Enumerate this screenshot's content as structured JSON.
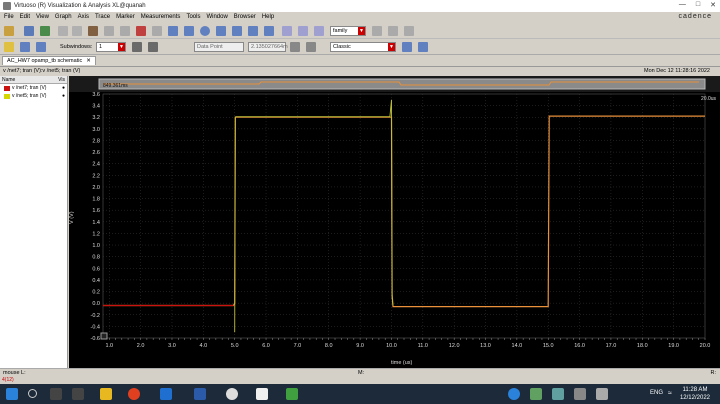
{
  "window": {
    "title": "Virtuoso (R) Visualization & Analysis XL@quanah"
  },
  "brand": "cadence",
  "menu": [
    "File",
    "Edit",
    "View",
    "Graph",
    "Axis",
    "Trace",
    "Marker",
    "Measurements",
    "Tools",
    "Window",
    "Browser",
    "Help"
  ],
  "toolbar": {
    "family_value": "family",
    "subwindows_label": "Subwindows:",
    "subwindows_value": "1",
    "data_point_value": "Data Point",
    "coord_value": "2.135027664m",
    "style_value": "Classic"
  },
  "tab": {
    "label": "AC_HW7 opamp_tb schematic"
  },
  "subtitle": {
    "traces": "v /net7; tran (V):v /net5; tran (V)",
    "datetime": "Mon Dec 12 11:28:16 2022"
  },
  "legend": {
    "header": "Name",
    "vis": "Vis",
    "items": [
      {
        "label": "v /net7; tran (V)",
        "color": "#cc1111"
      },
      {
        "label": "v /net5; tran (V)",
        "color": "#d6d600"
      }
    ]
  },
  "scroll": {
    "start_label": "849.361ms",
    "end_label": "20.0us"
  },
  "colors": {
    "output": "#e8903a",
    "input": "#cc1111",
    "input2": "#bfc23a",
    "grid": "#3a3a3a"
  },
  "chart_data": {
    "type": "line",
    "xlabel": "time (us)",
    "ylabel": "V (V)",
    "xlim": [
      0.8,
      20.0
    ],
    "ylim": [
      -0.6,
      3.6
    ],
    "xticks": [
      "1.0",
      "2.0",
      "3.0",
      "4.0",
      "5.0",
      "6.0",
      "7.0",
      "8.0",
      "9.0",
      "10.0",
      "11.0",
      "12.0",
      "13.0",
      "14.0",
      "15.0",
      "16.0",
      "17.0",
      "18.0",
      "19.0",
      "20.0"
    ],
    "yticks": [
      "-0.6",
      "-0.4",
      "-0.2",
      "0.0",
      "0.2",
      "0.4",
      "0.6",
      "0.8",
      "1.0",
      "1.2",
      "1.4",
      "1.6",
      "1.8",
      "2.0",
      "2.2",
      "2.4",
      "2.6",
      "2.8",
      "3.0",
      "3.2",
      "3.4",
      "3.6"
    ],
    "grid": true,
    "series": [
      {
        "name": "v /net7; tran (V)",
        "x": [
          0.8,
          4.96,
          5.0,
          5.02,
          10.0,
          10.02,
          10.05,
          15.0,
          15.03,
          20.0
        ],
        "y": [
          -0.04,
          -0.04,
          0.0,
          3.2,
          3.2,
          0.15,
          -0.06,
          -0.06,
          3.22,
          3.22
        ]
      },
      {
        "name": "v /net5; tran (V)",
        "x": [
          5.0,
          5.02,
          5.04,
          9.95,
          10.0,
          10.02,
          10.05
        ],
        "y": [
          -0.5,
          3.2,
          3.21,
          3.21,
          3.5,
          0.1,
          -0.04
        ]
      }
    ]
  },
  "status": {
    "left": "mouse L:",
    "mid": "M:",
    "right": "R:"
  },
  "cmd": {
    "prompt": "4(12)"
  },
  "taskbar": {
    "time": "11:28 AM",
    "date": "12/12/2022",
    "lang": "ENG"
  }
}
